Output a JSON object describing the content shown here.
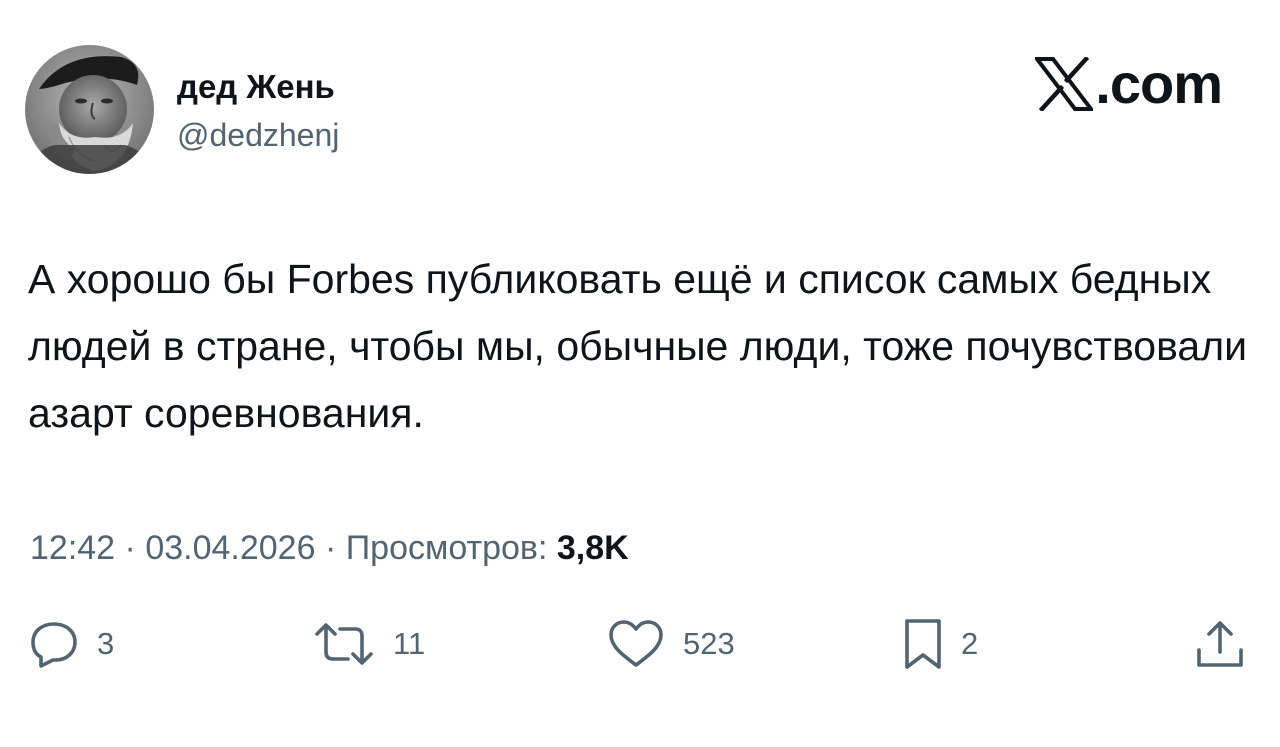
{
  "author": {
    "display_name": "дед Жень",
    "handle": "@dedzhenj",
    "avatar_icon": "user-photo-avatar"
  },
  "brand": {
    "suffix": ".com",
    "icon": "x-logo-icon"
  },
  "tweet": {
    "text": "А хорошо бы Forbes публиковать ещё и список самых бедных людей в стране, чтобы мы, обычные люди, тоже почувствовали азарт соревнования."
  },
  "meta": {
    "time": "12:42",
    "separator": "·",
    "date": "03.04.2026",
    "views_label": "Просмотров:",
    "views_count": "3,8K"
  },
  "actions": {
    "replies": {
      "count": "3",
      "icon": "reply-icon"
    },
    "reposts": {
      "count": "11",
      "icon": "repost-icon"
    },
    "likes": {
      "count": "523",
      "icon": "heart-icon"
    },
    "bookmarks": {
      "count": "2",
      "icon": "bookmark-icon"
    },
    "share": {
      "icon": "share-icon"
    }
  },
  "colors": {
    "text_primary": "#0f1419",
    "text_secondary": "#536471",
    "background": "#ffffff"
  }
}
